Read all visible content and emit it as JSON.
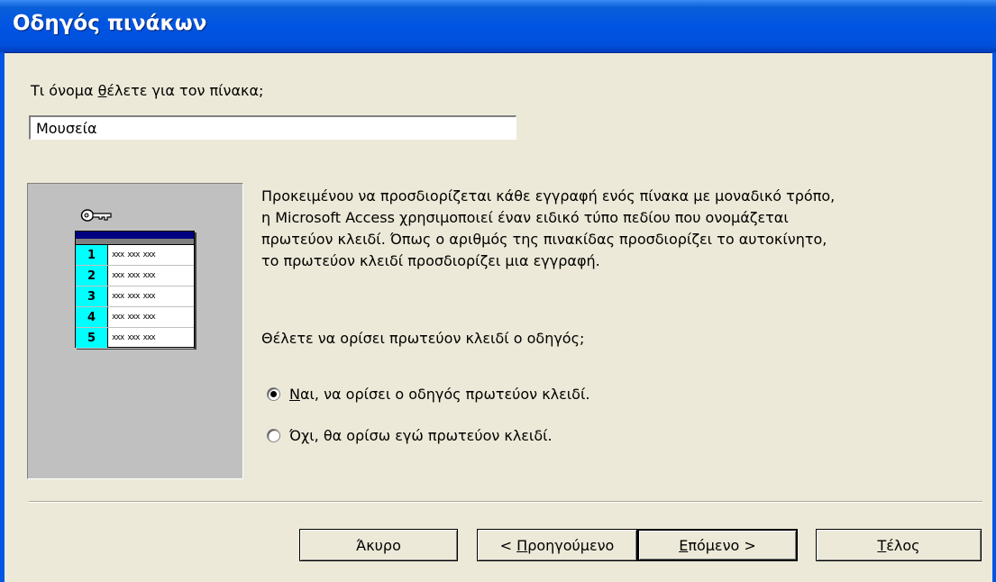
{
  "window": {
    "title": "Οδηγός πινάκων"
  },
  "name_prompt": {
    "before_hotkey": "Τι όνομα ",
    "hotkey": "θ",
    "after_hotkey": "έλετε για τον πίνακα;"
  },
  "name_input": {
    "value": "Μουσεία"
  },
  "illustration": {
    "rows": [
      "1",
      "2",
      "3",
      "4",
      "5"
    ],
    "cell_text": "xxx"
  },
  "description": "Προκειμένου να προσδιορίζεται κάθε εγγραφή ενός πίνακα με μοναδικό τρόπο, η Microsoft Access χρησιμοποιεί έναν ειδικό τύπο πεδίου που ονομάζεται πρωτεύον κλειδί. Όπως ο αριθμός της πινακίδας προσδιορίζει το αυτοκίνητο, το πρωτεύον κλειδί προσδιορίζει μια εγγραφή.",
  "question": "Θέλετε να ορίσει πρωτεύον κλειδί ο οδηγός;",
  "options": [
    {
      "hotkey": "Ν",
      "rest": "αι, να ορίσει ο οδηγός πρωτεύον κλειδί.",
      "checked": true
    },
    {
      "before": "Ό",
      "hotkey": "χ",
      "rest": "ι, θα ορίσω εγώ πρωτεύον κλειδί.",
      "checked": false
    }
  ],
  "buttons": {
    "cancel": "Άκυρο",
    "back_prefix": "< ",
    "back_hotkey": "Π",
    "back_rest": "ροηγούμενο",
    "next_hotkey": "Ε",
    "next_rest": "πόμενο >",
    "finish_hotkey": "Τ",
    "finish_rest": "έλος"
  }
}
